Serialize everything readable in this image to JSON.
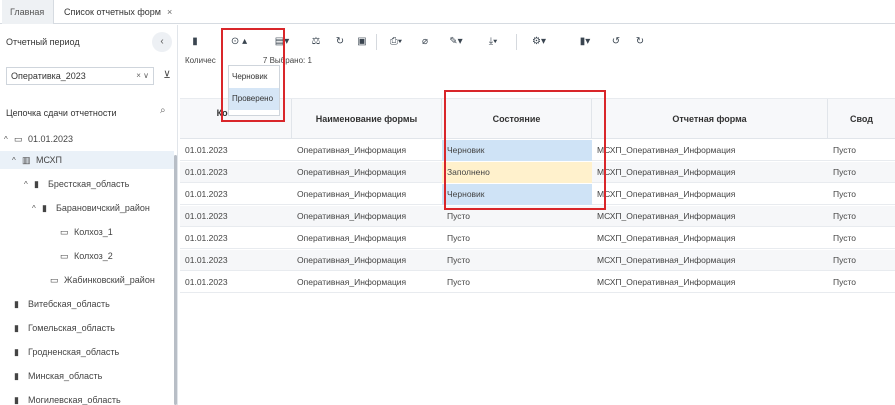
{
  "tabs": [
    {
      "label": "Главная"
    },
    {
      "label": "Список отчетных форм",
      "close": "×"
    }
  ],
  "sidebar": {
    "period_title": "Отчетный период",
    "collapse_icon": "chevron-left",
    "period_select_value": "Оперативка_2023",
    "period_select_controls": "× ∨",
    "chain_title": "Цепочка сдачи отчетности",
    "tree": [
      {
        "label": "01.01.2023",
        "arrow": "^",
        "icon": "folder"
      },
      {
        "label": "МСХП",
        "arrow": "^",
        "icon": "bank"
      },
      {
        "label": "Брестская_область",
        "arrow": "^",
        "icon": "building"
      },
      {
        "label": "Барановичский_район",
        "arrow": "^",
        "icon": "building"
      },
      {
        "label": "Колхоз_1",
        "arrow": "",
        "icon": "folder-outline"
      },
      {
        "label": "Колхоз_2",
        "arrow": "",
        "icon": "folder-outline"
      },
      {
        "label": "Жабинковский_район",
        "arrow": "",
        "icon": "folder-outline"
      },
      {
        "label": "Витебская_область",
        "arrow": "",
        "icon": "building"
      },
      {
        "label": "Гомельская_область",
        "arrow": "",
        "icon": "building"
      },
      {
        "label": "Гродненская_область",
        "arrow": "",
        "icon": "building"
      },
      {
        "label": "Минская_область",
        "arrow": "",
        "icon": "building"
      },
      {
        "label": "Могилевская_область",
        "arrow": "",
        "icon": "building"
      }
    ]
  },
  "status": {
    "count_text": "Количес",
    "selected_text": "7  Выбрано: 1"
  },
  "dropdown": {
    "items": [
      "Черновик",
      "Проверено"
    ]
  },
  "table": {
    "headers": {
      "period": "Ко отчет",
      "form_name": "Наименование формы",
      "state": "Состояние",
      "report_form": "Отчетная форма",
      "summary": "Свод"
    },
    "rows": [
      {
        "period": "01.01.2023",
        "form_name": "Оперативная_Информация",
        "state": "Черновик",
        "report_form": "МСХП_Оперативная_Информация",
        "summary": "Пусто"
      },
      {
        "period": "01.01.2023",
        "form_name": "Оперативная_Информация",
        "state": "Заполнено",
        "report_form": "МСХП_Оперативная_Информация",
        "summary": "Пусто"
      },
      {
        "period": "01.01.2023",
        "form_name": "Оперативная_Информация",
        "state": "Черновик",
        "report_form": "МСХП_Оперативная_Информация",
        "summary": "Пусто"
      },
      {
        "period": "01.01.2023",
        "form_name": "Оперативная_Информация",
        "state": "Пусто",
        "report_form": "МСХП_Оперативная_Информация",
        "summary": "Пусто"
      },
      {
        "period": "01.01.2023",
        "form_name": "Оперативная_Информация",
        "state": "Пусто",
        "report_form": "МСХП_Оперативная_Информация",
        "summary": "Пусто"
      },
      {
        "period": "01.01.2023",
        "form_name": "Оперативная_Информация",
        "state": "Пусто",
        "report_form": "МСХП_Оперативная_Информация",
        "summary": "Пусто"
      },
      {
        "period": "01.01.2023",
        "form_name": "Оперативная_Информация",
        "state": "Пусто",
        "report_form": "МСХП_Оперативная_Информация",
        "summary": "Пусто"
      }
    ]
  },
  "colors": {
    "highlight_red": "#d9262a",
    "selected_blue": "#cfe3f6",
    "filled_yellow": "#fff1cc"
  }
}
